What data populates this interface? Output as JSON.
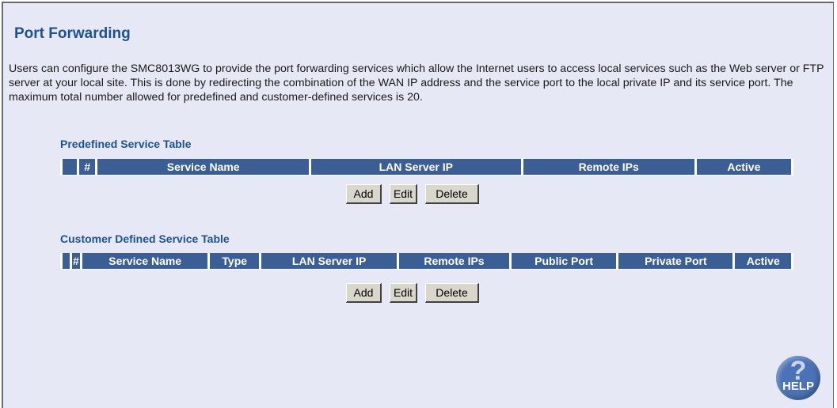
{
  "page": {
    "title": "Port Forwarding",
    "description": "Users can configure the SMC8013WG to provide the port forwarding services which allow the Internet users to access local services such as the Web server or FTP server at your local site. This is done by redirecting the combination of the WAN IP address and the service port to the local private IP and its service port. The maximum total number allowed for predefined and customer-defined services is 20."
  },
  "predefined": {
    "title": "Predefined Service Table",
    "columns": [
      "",
      "#",
      "Service Name",
      "LAN Server IP",
      "Remote IPs",
      "Active"
    ],
    "buttons": {
      "add": "Add",
      "edit": "Edit",
      "delete": "Delete"
    }
  },
  "customer": {
    "title": "Customer Defined Service Table",
    "columns": [
      "",
      "#",
      "Service Name",
      "Type",
      "LAN Server IP",
      "Remote IPs",
      "Public Port",
      "Private Port",
      "Active"
    ],
    "buttons": {
      "add": "Add",
      "edit": "Edit",
      "delete": "Delete"
    }
  },
  "help": {
    "icon": "question-mark-icon",
    "label": "HELP"
  },
  "colors": {
    "panel_bg": "#e6e9f5",
    "title": "#1e5190",
    "header_bg": "#3b5f94",
    "button_bg": "#d9d6cc",
    "help_bg": "#4b72b5"
  }
}
